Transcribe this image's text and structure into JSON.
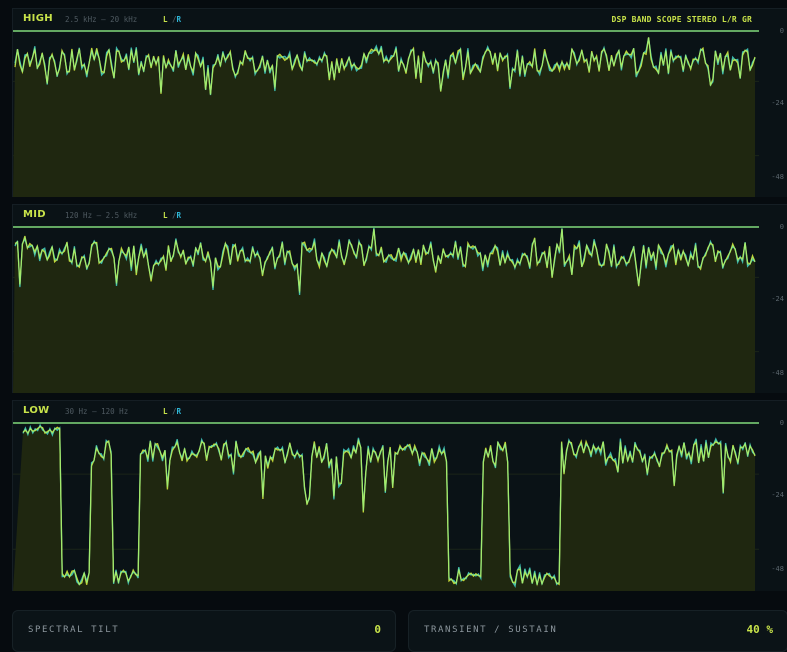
{
  "header": {
    "title": "DSP BAND SCOPE STEREO L/R GR"
  },
  "bands": [
    {
      "id": "high",
      "name": "HIGH",
      "range": "2.5 kHz – 20 kHz",
      "ch_l": "L",
      "ch_sep": " /",
      "ch_r": "R",
      "ticks": [
        "0",
        "-24",
        "-48"
      ],
      "profile": "high"
    },
    {
      "id": "mid",
      "name": "MID",
      "range": "120 Hz – 2.5 kHz",
      "ch_l": "L",
      "ch_sep": " /",
      "ch_r": "R",
      "ticks": [
        "0",
        "-24",
        "-48"
      ],
      "profile": "mid"
    },
    {
      "id": "low",
      "name": "LOW",
      "range": "30 Hz – 120 Hz",
      "ch_l": "L",
      "ch_sep": " /",
      "ch_r": "R",
      "ticks": [
        "0",
        "-24",
        "-48"
      ],
      "profile": "low"
    }
  ],
  "scale": {
    "top_db": 0,
    "bottom_db": -54
  },
  "colors": {
    "left": "#d4e83a",
    "right": "#3fd0c9",
    "mix": "#8ef088",
    "fill": "#1f2710",
    "ceiling": "#8ef088"
  },
  "meters": [
    {
      "id": "spectral-tilt",
      "label": "SPECTRAL TILT",
      "value": "0"
    },
    {
      "id": "transient-sustain",
      "label": "TRANSIENT / SUSTAIN",
      "value": "40 %"
    }
  ]
}
